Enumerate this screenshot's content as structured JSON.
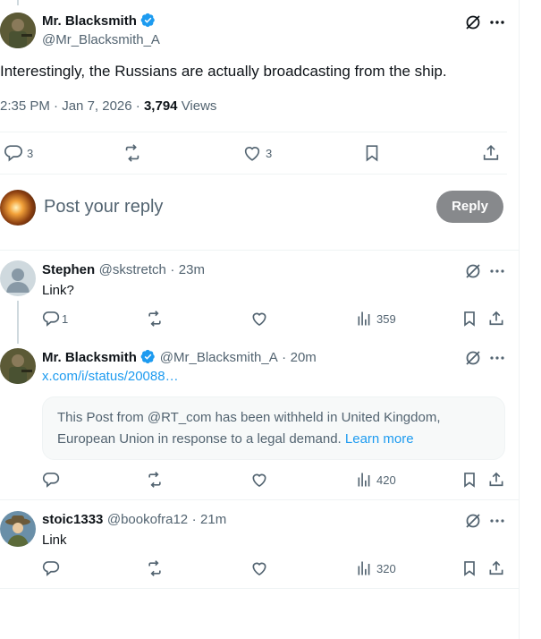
{
  "main_post": {
    "author_name": "Mr. Blacksmith",
    "author_handle": "@Mr_Blacksmith_A",
    "text": "Interestingly, the Russians are actually broadcasting from the ship.",
    "time": "2:35 PM",
    "date": "Jan 7, 2026",
    "views_count": "3,794",
    "views_label": "Views",
    "replies": "3",
    "likes": "3"
  },
  "reply_composer": {
    "placeholder": "Post your reply",
    "button_label": "Reply"
  },
  "replies": [
    {
      "author_name": "Stephen",
      "author_handle": "@skstretch",
      "time": "23m",
      "text": "Link?",
      "reply_count": "1",
      "views": "359"
    },
    {
      "author_name": "Mr. Blacksmith",
      "author_handle": "@Mr_Blacksmith_A",
      "time": "20m",
      "link_text": "x.com/i/status/20088…",
      "withheld_line1": "This Post from @RT_com has been withheld in United Kingdom,",
      "withheld_line2": "European Union in response to a legal demand.",
      "learn_more": "Learn more",
      "views": "420"
    },
    {
      "author_name": "stoic1333",
      "author_handle": "@bookofra12",
      "time": "21m",
      "text": "Link",
      "views": "320"
    }
  ],
  "separator": "·",
  "colors": {
    "accent": "#1d9bf0",
    "muted": "#536471",
    "reply_button_bg": "#87898c",
    "border": "#eff3f4"
  }
}
